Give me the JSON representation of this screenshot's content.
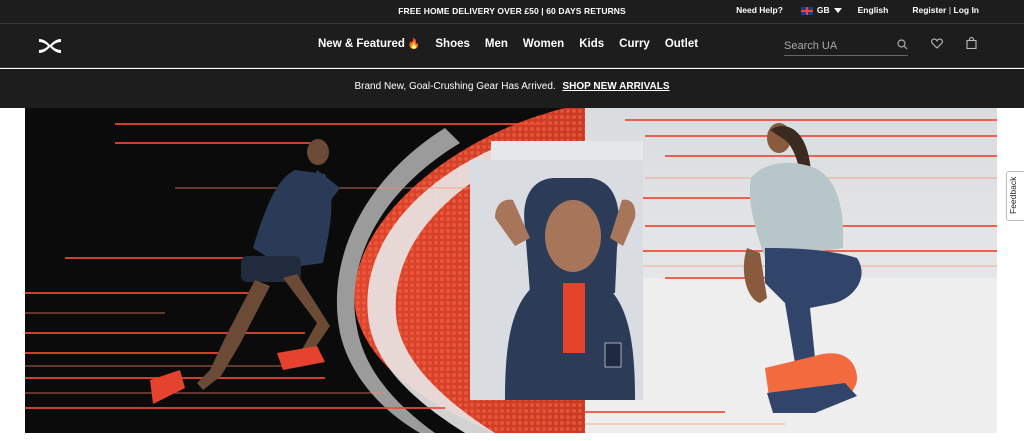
{
  "topbar": {
    "promo": "FREE HOME DELIVERY OVER £50 | 60 DAYS RETURNS",
    "need_help": "Need Help?",
    "region": "GB",
    "language": "English",
    "register": "Register",
    "separator": "|",
    "login": "Log In"
  },
  "nav": {
    "logo_name": "under-armour-logo",
    "items": [
      "New & Featured",
      "Shoes",
      "Men",
      "Women",
      "Kids",
      "Curry",
      "Outlet"
    ],
    "featured_flame": "🔥",
    "search_placeholder": "Search UA"
  },
  "announcement": {
    "text": "Brand New, Goal-Crushing Gear Has Arrived.",
    "link": "SHOP NEW ARRIVALS"
  },
  "feedback": {
    "label": "Feedback"
  },
  "colors": {
    "bar_bg": "#1d1d1d",
    "track_red": "#e2472f",
    "accent_orange": "#ff5a2e"
  }
}
